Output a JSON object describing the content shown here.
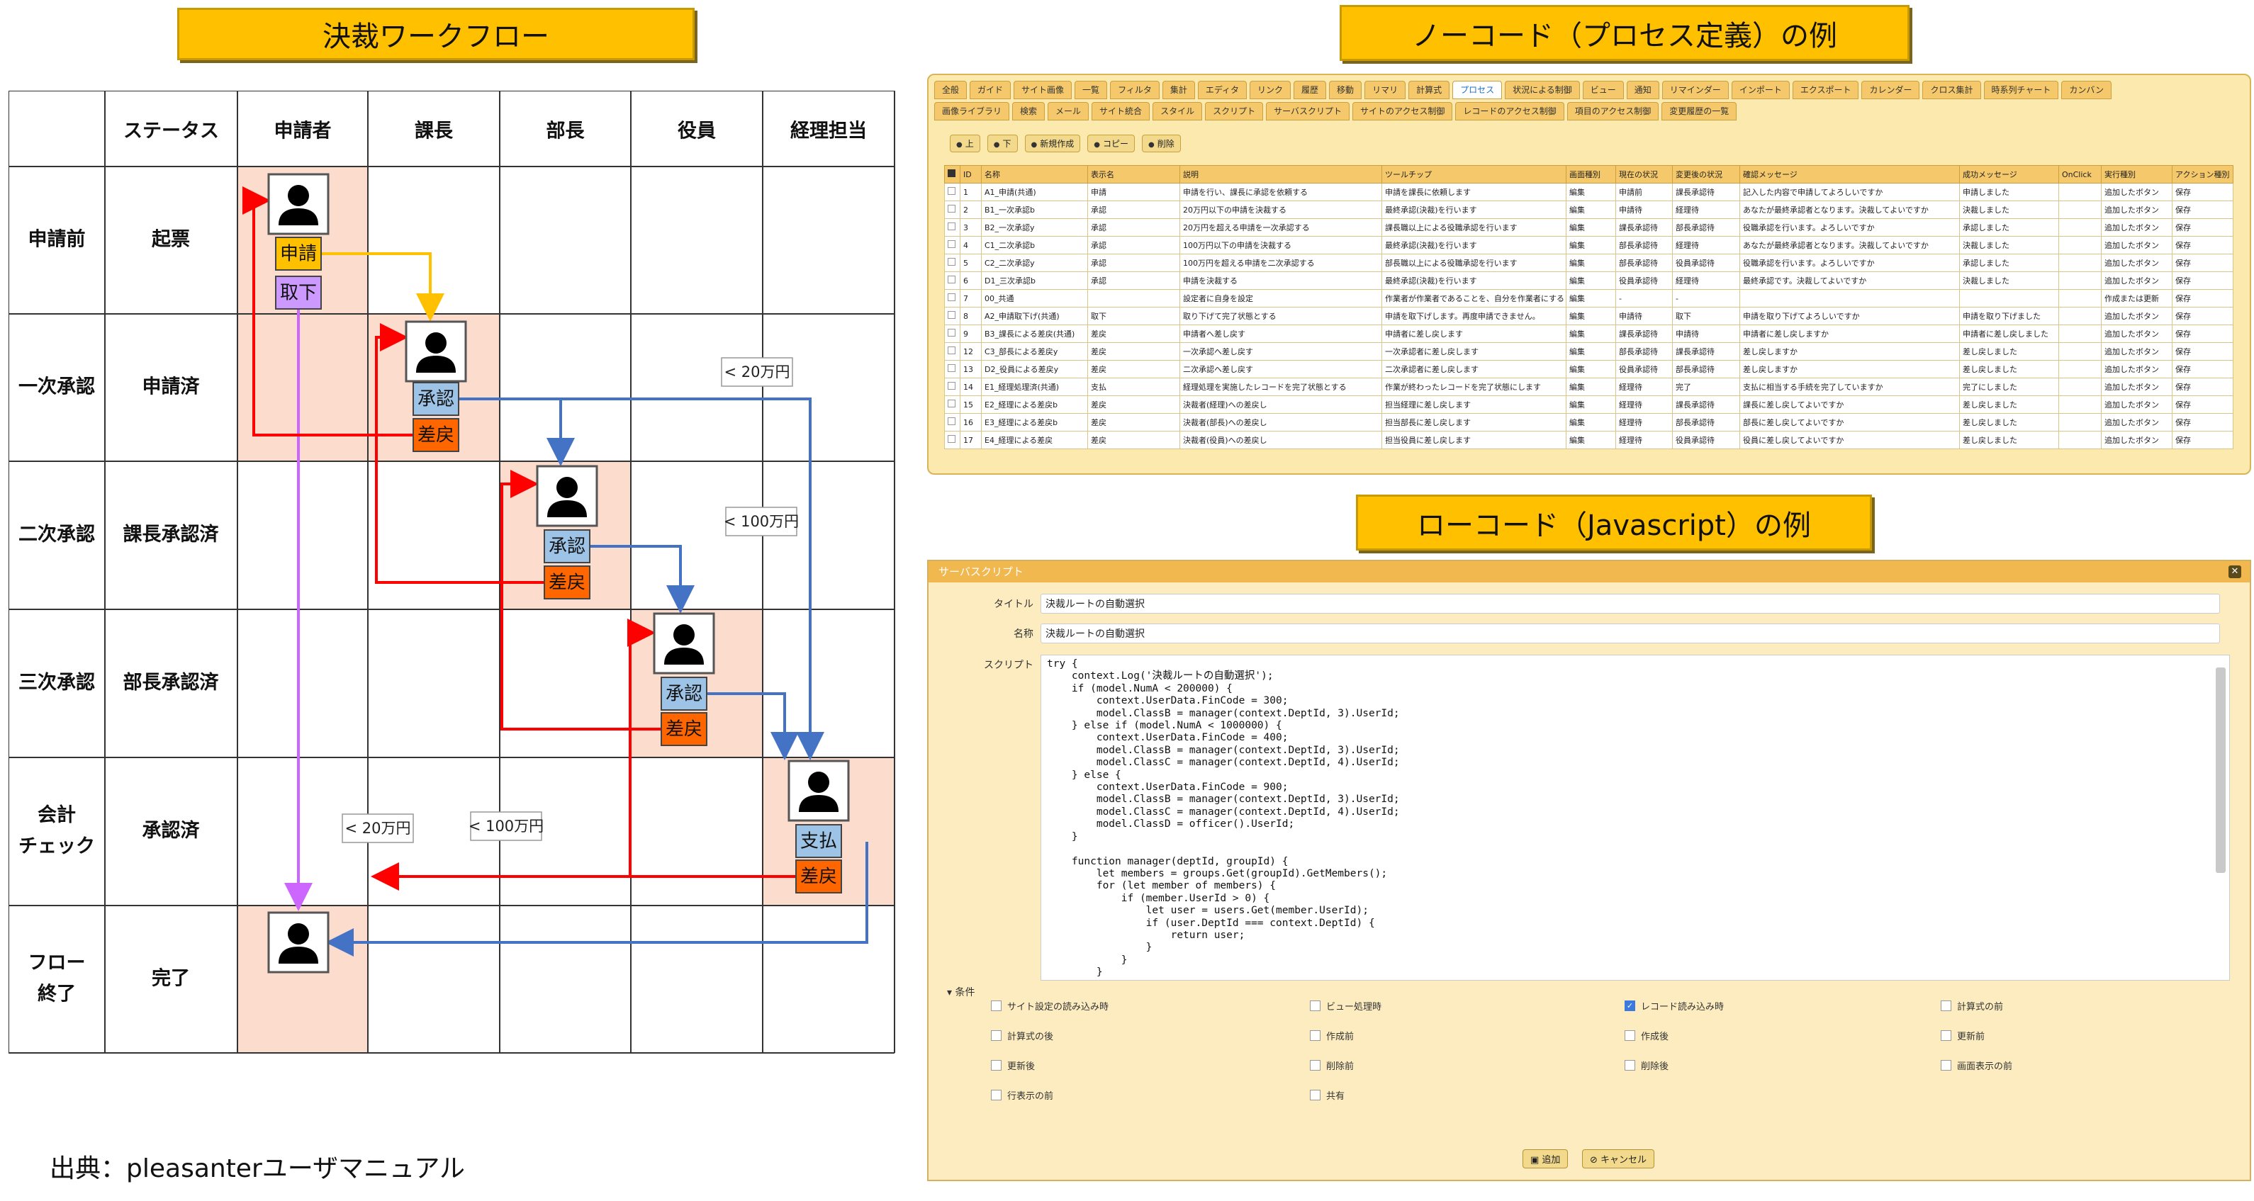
{
  "banners": {
    "workflow": "決裁ワークフロー",
    "nocode": "ノーコード（プロセス定義）の例",
    "lowcode": "ローコード（Javascript）の例"
  },
  "credit": "出典：pleasanterユーザマニュアル",
  "workflow": {
    "headers": [
      "",
      "ステータス",
      "申請者",
      "課長",
      "部長",
      "役員",
      "経理担当"
    ],
    "rows": [
      {
        "stage": "申請前",
        "status": "起票"
      },
      {
        "stage": "一次承認",
        "status": "申請済"
      },
      {
        "stage": "二次承認",
        "status": "課長承認済"
      },
      {
        "stage": "三次承認",
        "status": "部長承認済"
      },
      {
        "stage": "会計\nチェック",
        "status": "承認済"
      },
      {
        "stage": "フロー\n終了",
        "status": "完了"
      }
    ],
    "buttons": {
      "apply": "申請",
      "withdraw": "取下",
      "approve": "承認",
      "sendback": "差戻",
      "pay": "支払"
    },
    "labels": {
      "lt20": "< 20万円",
      "lt100": "< 100万円"
    },
    "colors": {
      "apply": "#ffc000",
      "withdraw": "#cc99ff",
      "approve": "#9dc3e6",
      "sendback": "#ff6600",
      "lane": "#fbdccd"
    }
  },
  "nocode": {
    "tabs_row1": [
      "全般",
      "ガイド",
      "サイト画像",
      "一覧",
      "フィルタ",
      "集計",
      "エディタ",
      "リンク",
      "履歴",
      "移動",
      "リマリ",
      "計算式",
      "プロセス",
      "状況による制御",
      "ビュー",
      "通知",
      "リマインダー",
      "インポート",
      "エクスポート",
      "カレンダー",
      "クロス集計",
      "時系列チャート",
      "カンバン"
    ],
    "tabs_row2": [
      "画像ライブラリ",
      "検索",
      "メール",
      "サイト統合",
      "スタイル",
      "スクリプト",
      "サーバスクリプト",
      "サイトのアクセス制御",
      "レコードのアクセス制御",
      "項目のアクセス制御",
      "変更履歴の一覧"
    ],
    "active_tab": "プロセス",
    "buttons": [
      "上",
      "下",
      "新規作成",
      "コピー",
      "削除"
    ],
    "columns": [
      "",
      "ID",
      "名称",
      "表示名",
      "説明",
      "ツールチップ",
      "画面種別",
      "現在の状況",
      "変更後の状況",
      "確認メッセージ",
      "成功メッセージ",
      "OnClick",
      "実行種別",
      "アクション種別"
    ],
    "rows": [
      [
        "",
        "1",
        "A1_申請(共通)",
        "申請",
        "申請を行い、課長に承認を依頼する",
        "申請を課長に依頼します",
        "編集",
        "申請前",
        "課長承認待",
        "記入した内容で申請してよろしいですか",
        "申請しました",
        "",
        "追加したボタン",
        "保存"
      ],
      [
        "",
        "2",
        "B1_一次承認b",
        "承認",
        "20万円以下の申請を決裁する",
        "最終承認(決裁)を行います",
        "編集",
        "申請待",
        "経理待",
        "あなたが最終承認者となります。決裁してよいですか",
        "決裁しました",
        "",
        "追加したボタン",
        "保存"
      ],
      [
        "",
        "3",
        "B2_一次承認y",
        "承認",
        "20万円を超える申請を一次承認する",
        "課長職以上による役職承認を行います",
        "編集",
        "課長承認待",
        "部長承認待",
        "役職承認を行います。よろしいですか",
        "承認しました",
        "",
        "追加したボタン",
        "保存"
      ],
      [
        "",
        "4",
        "C1_二次承認b",
        "承認",
        "100万円以下の申請を決裁する",
        "最終承認(決裁)を行います",
        "編集",
        "部長承認待",
        "経理待",
        "あなたが最終承認者となります。決裁してよいですか",
        "決裁しました",
        "",
        "追加したボタン",
        "保存"
      ],
      [
        "",
        "5",
        "C2_二次承認y",
        "承認",
        "100万円を超える申請を二次承認する",
        "部長職以上による役職承認を行います",
        "編集",
        "部長承認待",
        "役員承認待",
        "役職承認を行います。よろしいですか",
        "承認しました",
        "",
        "追加したボタン",
        "保存"
      ],
      [
        "",
        "6",
        "D1_三次承認b",
        "承認",
        "申請を決裁する",
        "最終承認(決裁)を行います",
        "編集",
        "役員承認待",
        "経理待",
        "最終承認です。決裁してよいですか",
        "決裁しました",
        "",
        "追加したボタン",
        "保存"
      ],
      [
        "",
        "7",
        "00_共通",
        "",
        "設定者に自身を設定",
        "作業者が作業者であることを、自分を作業者にする",
        "編集",
        "-",
        "-",
        "",
        "",
        "",
        "作成または更新",
        "保存"
      ],
      [
        "",
        "8",
        "A2_申請取下げ(共通)",
        "取下",
        "取り下げて完了状態とする",
        "申請を取下げします。再度申請できません。",
        "編集",
        "申請待",
        "取下",
        "申請を取り下げてよろしいですか",
        "申請を取り下げました",
        "",
        "追加したボタン",
        "保存"
      ],
      [
        "",
        "9",
        "B3_課長による差戻(共通)",
        "差戻",
        "申請者へ差し戻す",
        "申請者に差し戻します",
        "編集",
        "課長承認待",
        "申請待",
        "申請者に差し戻しますか",
        "申請者に差し戻しました",
        "",
        "追加したボタン",
        "保存"
      ],
      [
        "",
        "12",
        "C3_部長による差戻y",
        "差戻",
        "一次承認へ差し戻す",
        "一次承認者に差し戻します",
        "編集",
        "部長承認待",
        "課長承認待",
        "差し戻しますか",
        "差し戻しました",
        "",
        "追加したボタン",
        "保存"
      ],
      [
        "",
        "13",
        "D2_役員による差戻y",
        "差戻",
        "二次承認へ差し戻す",
        "二次承認者に差し戻します",
        "編集",
        "役員承認待",
        "部長承認待",
        "差し戻しますか",
        "差し戻しました",
        "",
        "追加したボタン",
        "保存"
      ],
      [
        "",
        "14",
        "E1_経理処理済(共通)",
        "支払",
        "経理処理を実施したレコードを完了状態とする",
        "作業が終わったレコードを完了状態にします",
        "編集",
        "経理待",
        "完了",
        "支払に相当する手続を完了していますか",
        "完了にしました",
        "",
        "追加したボタン",
        "保存"
      ],
      [
        "",
        "15",
        "E2_経理による差戻b",
        "差戻",
        "決裁者(経理)への差戻し",
        "担当経理に差し戻します",
        "編集",
        "経理待",
        "課長承認待",
        "課長に差し戻してよいですか",
        "差し戻しました",
        "",
        "追加したボタン",
        "保存"
      ],
      [
        "",
        "16",
        "E3_経理による差戻b",
        "差戻",
        "決裁者(部長)への差戻し",
        "担当部長に差し戻します",
        "編集",
        "経理待",
        "部長承認待",
        "部長に差し戻してよいですか",
        "差し戻しました",
        "",
        "追加したボタン",
        "保存"
      ],
      [
        "",
        "17",
        "E4_経理による差戻",
        "差戻",
        "決裁者(役員)への差戻し",
        "担当役員に差し戻します",
        "編集",
        "経理待",
        "役員承認待",
        "役員に差し戻してよいですか",
        "差し戻しました",
        "",
        "追加したボタン",
        "保存"
      ]
    ]
  },
  "lowcode": {
    "window_title": "サーバスクリプト",
    "close": "✕",
    "title_label": "タイトル",
    "title_value": "決裁ルートの自動選択",
    "name_label": "名称",
    "name_value": "決裁ルートの自動選択",
    "script_label": "スクリプト",
    "script": "try {\n    context.Log('決裁ルートの自動選択');\n    if (model.NumA < 200000) {\n        context.UserData.FinCode = 300;\n        model.ClassB = manager(context.DeptId, 3).UserId;\n    } else if (model.NumA < 1000000) {\n        context.UserData.FinCode = 400;\n        model.ClassB = manager(context.DeptId, 3).UserId;\n        model.ClassC = manager(context.DeptId, 4).UserId;\n    } else {\n        context.UserData.FinCode = 900;\n        model.ClassB = manager(context.DeptId, 3).UserId;\n        model.ClassC = manager(context.DeptId, 4).UserId;\n        model.ClassD = officer().UserId;\n    }\n\n    function manager(deptId, groupId) {\n        let members = groups.Get(groupId).GetMembers();\n        for (let member of members) {\n            if (member.UserId > 0) {\n                let user = users.Get(member.UserId);\n                if (user.DeptId === context.DeptId) {\n                    return user;\n                }\n            }\n        }",
    "cond_header": "条件",
    "conditions": [
      {
        "label": "サイト設定の読み込み時",
        "checked": false
      },
      {
        "label": "ビュー処理時",
        "checked": false
      },
      {
        "label": "レコード読み込み時",
        "checked": true
      },
      {
        "label": "計算式の前",
        "checked": false
      },
      {
        "label": "計算式の後",
        "checked": false
      },
      {
        "label": "作成前",
        "checked": false
      },
      {
        "label": "作成後",
        "checked": false
      },
      {
        "label": "更新前",
        "checked": false
      },
      {
        "label": "更新後",
        "checked": false
      },
      {
        "label": "削除前",
        "checked": false
      },
      {
        "label": "削除後",
        "checked": false
      },
      {
        "label": "画面表示の前",
        "checked": false
      },
      {
        "label": "行表示の前",
        "checked": false
      },
      {
        "label": "共有",
        "checked": false
      }
    ],
    "add_button": "追加",
    "cancel_button": "キャンセル"
  }
}
